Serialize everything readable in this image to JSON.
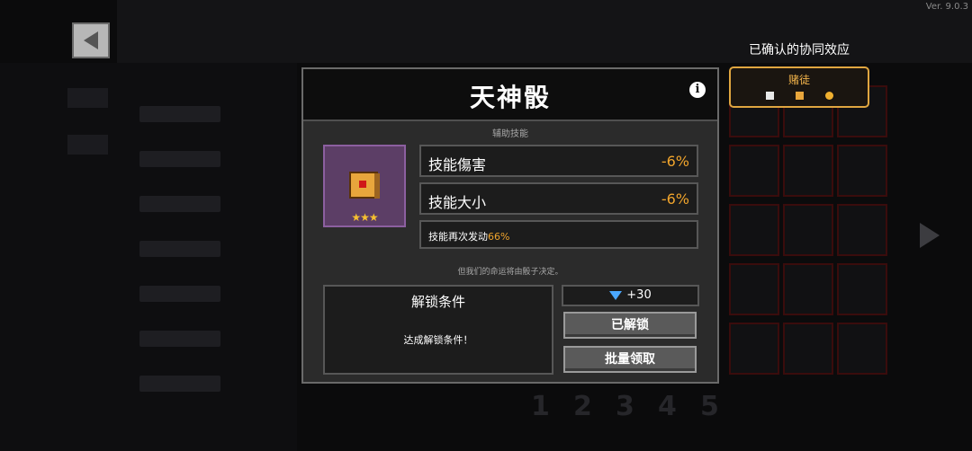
{
  "version": "Ver. 9.0.3",
  "synergy": {
    "title": "已确认的协同效应",
    "name": "赌徒",
    "accent": "#e0a640"
  },
  "modal": {
    "title": "天神骰",
    "subtitle": "辅助技能",
    "item_rarity_stars": "★★★",
    "stats": [
      {
        "label": "技能傷害",
        "value": "-6%"
      },
      {
        "label": "技能大小",
        "value": "-6%"
      }
    ],
    "note": {
      "label": "技能再次发动",
      "value": "66%"
    },
    "flavor": "但我们的命运将由骰子决定。",
    "unlock": {
      "title": "解锁条件",
      "description": "达成解锁条件！"
    },
    "reward": "+30",
    "buttons": {
      "unlocked": "已解锁",
      "batch_claim": "批量领取"
    }
  },
  "background_pages": [
    "1",
    "2",
    "3",
    "4",
    "5"
  ],
  "colors": {
    "value_orange": "#f0a42c",
    "item_purple": "#5c3e66"
  }
}
